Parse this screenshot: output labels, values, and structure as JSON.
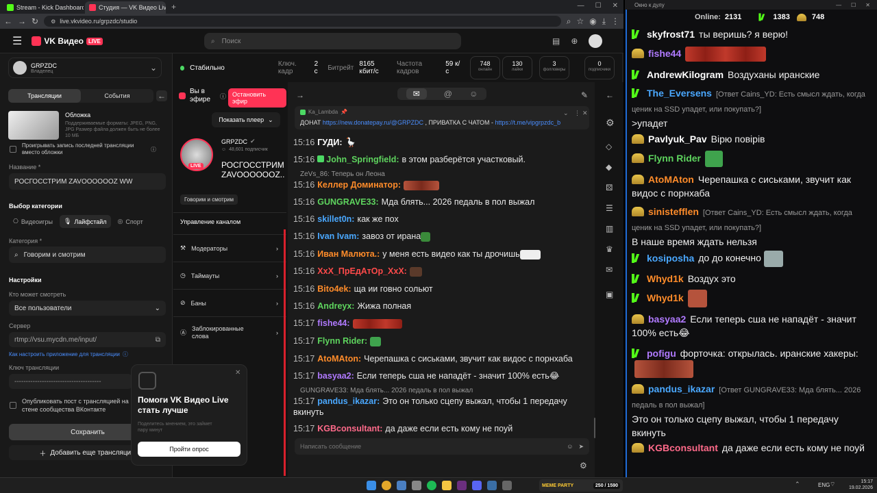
{
  "browser": {
    "tabs": [
      {
        "label": "Stream - Kick Dashboard"
      },
      {
        "label": "Студия — VK Видео Live"
      }
    ],
    "url": "live.vkvideo.ru/grpzdc/studio",
    "new_tab": "+"
  },
  "header": {
    "logo": "VK Видео",
    "live_badge": "LIVE",
    "search_placeholder": "Поиск"
  },
  "channel": {
    "name": "GRPZDC",
    "role": "Владелец"
  },
  "tabs": {
    "broadcasts": "Трансляции",
    "events": "События"
  },
  "cover": {
    "title": "Обложка",
    "hint": "Поддерживаемые форматы: JPEG, PNG, JPG Размер файла должен быть не более 10 МБ",
    "checkbox": "Проигрывать запись последней трансляции вместо обложки"
  },
  "form": {
    "name_label": "Название *",
    "name_value": "РОСГОССТРИМ ZAVOOOOOOZ WW",
    "category_choice": "Выбор категории",
    "cat_games": "Видеоигры",
    "cat_life": "Лайфстайл",
    "cat_sport": "Спорт",
    "category_label": "Категория *",
    "category_value": "Говорим и смотрим",
    "settings": "Настройки",
    "who_label": "Кто может смотреть",
    "who_value": "Все пользователи",
    "server_label": "Сервер",
    "server_value": "rtmp://vsu.mycdn.me/input/",
    "setup_link": "Как настроить приложение для трансляции",
    "key_label": "Ключ трансляции",
    "key_value": "--------------------------------------",
    "publish": "Опубликовать пост с трансляцией на стене сообщества ВКонтакте",
    "save": "Сохранить",
    "add_more": "Добавить еще трансляцию"
  },
  "status": {
    "state": "Стабильно",
    "keyframe_label": "Ключ. кадр",
    "keyframe_value": "2 с",
    "bitrate_label": "Битрейт",
    "bitrate_value": "8165 кбит/с",
    "fps_label": "Частота кадров",
    "fps_value": "59 к/с"
  },
  "stats": [
    {
      "value": "748",
      "label": "онлайн"
    },
    {
      "value": "130",
      "label": "лайки"
    },
    {
      "value": "3",
      "label": "фолловеры"
    },
    {
      "value": "0",
      "label": "подписчики"
    }
  ],
  "onair": {
    "label": "Вы в эфире",
    "stop": "Остановить эфир",
    "show_player": "Показать плеер",
    "streamer": "GRPZDC",
    "subs": "48,601 подписчик",
    "title": "РОСГОССТРИМ ZAVOOOOOOZ...",
    "category": "Говорим и смотрим",
    "live": "LIVE"
  },
  "manage": {
    "title": "Управление каналом",
    "items": [
      "Модераторы",
      "Таймауты",
      "Баны",
      "Заблокированные слова"
    ]
  },
  "pinned": {
    "author": "Ka_Lambda",
    "text": "ДОНАТ ",
    "link1": "https://new.donatepay.ru/@GRPZDC",
    "mid": " , ПРИВАТКА С ЧАТОМ - ",
    "link2": "https://t.me/vipgrpzdc_bot ,..."
  },
  "chat": {
    "messages": [
      {
        "time": "15:16",
        "name": "ГУДИ:",
        "color": "#ffffff",
        "text": ""
      },
      {
        "time": "15:16",
        "name": "John_Springfield:",
        "color": "#5ed45e",
        "text": "в этом разберётся участковый."
      },
      {
        "time": "15:16",
        "name": "Келлер Доминатор:",
        "color": "#ff8c2a",
        "text": ""
      },
      {
        "time": "15:16",
        "name": "GUNGRAVE33:",
        "color": "#5ed45e",
        "text": "Мда блять... 2026 педаль в пол выжал"
      },
      {
        "time": "15:16",
        "name": "skillet0n:",
        "color": "#4aa8ff",
        "text": "как же пох"
      },
      {
        "time": "15:16",
        "name": "Ivan Ivam:",
        "color": "#4aa8ff",
        "text": "завоз от ирана"
      },
      {
        "time": "15:16",
        "name": "Иван Малюта.:",
        "color": "#ff8c2a",
        "text": "у меня есть видео как ты дрочишь"
      },
      {
        "time": "15:16",
        "name": "XxX_ПрЕдАтОр_XxX:",
        "color": "#ff4a4a",
        "text": ""
      },
      {
        "time": "15:16",
        "name": "Bito4ek:",
        "color": "#ff8c2a",
        "text": "ща ии говно сольют"
      },
      {
        "time": "15:16",
        "name": "Andreyx:",
        "color": "#5ed45e",
        "text": "Жижа полная"
      },
      {
        "time": "15:17",
        "name": "fishe44:",
        "color": "#b07aff",
        "text": ""
      },
      {
        "time": "15:17",
        "name": "Flynn Rider:",
        "color": "#5ed45e",
        "text": ""
      },
      {
        "time": "15:17",
        "name": "AtoMAton:",
        "color": "#ff8c2a",
        "text": "Черепашка с сиськами, звучит как видос с порнхаба"
      },
      {
        "time": "15:17",
        "name": "basyaa2:",
        "color": "#b07aff",
        "text": "Если теперь сша не нападёт - значит 100% есть"
      },
      {
        "time": "15:17",
        "name": "pandus_ikazar:",
        "color": "#4aa8ff",
        "text": "Это он только сцепу выжал, чтобы 1 передачу вкинуть"
      },
      {
        "time": "15:17",
        "name": "KGBconsultant:",
        "color": "#ff6a8a",
        "text": "да даже если есть кому не поуй"
      }
    ],
    "sys1": "ZeVs_86: Теперь он Леона",
    "sys2": "GUNGRAVE33: Мда блять... 2026 педаль в пол выжал",
    "input_placeholder": "Написать сообщение"
  },
  "survey": {
    "title": "Помоги VK Видео Live стать лучше",
    "desc": "Поделитесь мнением, это займет пару минут",
    "button": "Пройти опрос"
  },
  "overlay": {
    "window_title": "Окно к дулу",
    "online_label": "Online:",
    "online_value": "2131",
    "kick_count": "1383",
    "vk_count": "748",
    "messages": [
      {
        "src": "kick",
        "name": "skyfrost71",
        "color": "#ffffff",
        "text": "ты веришь? я верю!"
      },
      {
        "src": "vk",
        "name": "fishe44",
        "color": "#b07aff",
        "text": ""
      },
      {
        "src": "kick",
        "name": "AndrewKilogram",
        "color": "#ffffff",
        "text": "Воздуханы иранские"
      },
      {
        "src": "kick",
        "name": "The_Eversens",
        "color": "#4aa8ff",
        "reply": "[Ответ Cains_YD: Есть смысл ждать, когда ценик на SSD упадет, или покупать?]",
        "text": ">упадет"
      },
      {
        "src": "vk",
        "name": "Pavlyuk_Pav",
        "color": "#ffffff",
        "text": "Вірю повірів"
      },
      {
        "src": "vk",
        "name": "Flynn Rider",
        "color": "#5ed45e",
        "text": ""
      },
      {
        "src": "vk",
        "name": "AtoMAton",
        "color": "#ff8c2a",
        "text": "Черепашка с сиськами, звучит как видос с порнхаба"
      },
      {
        "src": "vk",
        "name": "sinistefflen",
        "color": "#ff8c2a",
        "reply": "[Ответ Cains_YD: Есть смысл ждать, когда ценик на SSD упадет, или покупать?]",
        "text": "В наше время ждать нельзя"
      },
      {
        "src": "kick",
        "name": "kosiposha",
        "color": "#4aa8ff",
        "text": "до до конечно"
      },
      {
        "src": "kick",
        "name": "Whyd1k",
        "color": "#ff8c2a",
        "text": "Воздух это"
      },
      {
        "src": "kick",
        "name": "Whyd1k",
        "color": "#ff8c2a",
        "text": ""
      },
      {
        "src": "vk",
        "name": "basyaa2",
        "color": "#b07aff",
        "text": "Если теперь сша не нападёт - значит 100% есть"
      },
      {
        "src": "kick",
        "name": "pofigu",
        "color": "#b07aff",
        "text": "форточка: открылась. иранские хакеры:"
      },
      {
        "src": "vk",
        "name": "pandus_ikazar",
        "color": "#4aa8ff",
        "reply": "[Ответ GUNGRAVE33: Мда блять... 2026 педаль в пол выжал]",
        "text": "Это он только сцепу выжал, чтобы 1 передачу вкинуть"
      },
      {
        "src": "vk",
        "name": "KGBconsultant",
        "color": "#ff6a8a",
        "text": "да даже если есть кому не поуй"
      }
    ]
  },
  "taskbar": {
    "lang": "ENG",
    "time": "15:17",
    "date": "19.02.2026",
    "meme": "MEME PARTY",
    "meme_count": "250 / 1590"
  }
}
